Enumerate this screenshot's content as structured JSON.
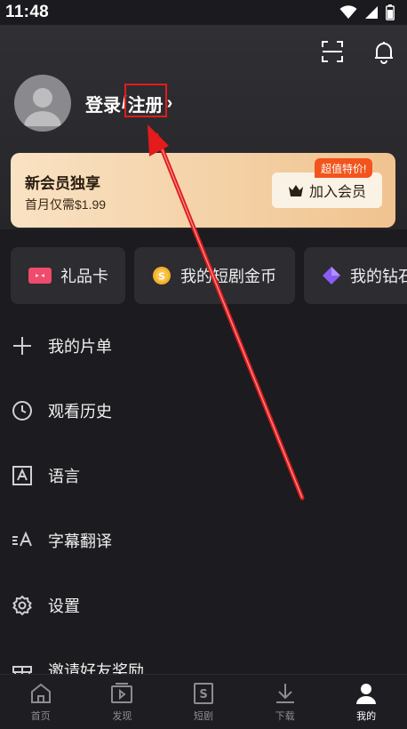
{
  "status_bar": {
    "time": "11:48",
    "icons": [
      "wifi-icon",
      "signal-icon",
      "battery-icon"
    ]
  },
  "header": {
    "icons": [
      "scan-icon",
      "bell-icon"
    ],
    "login_label": "登录",
    "separator": "/",
    "register_label": "注册",
    "chevron": "›"
  },
  "vip": {
    "title": "新会员独享",
    "price_text": "首月仅需$1.99",
    "badge": "超值特价!",
    "join_label": "加入会员",
    "colors": {
      "card_start": "#f9e2c3",
      "card_end": "#f0c38f",
      "badge": "#f2541c"
    }
  },
  "quick_actions": [
    {
      "label": "礼品卡",
      "icon": "gift-card-icon"
    },
    {
      "label": "我的短剧金币",
      "icon": "coin-icon"
    },
    {
      "label": "我的钻石",
      "icon": "diamond-icon"
    }
  ],
  "menu": [
    {
      "label": "我的片单",
      "icon": "plus-icon"
    },
    {
      "label": "观看历史",
      "icon": "clock-icon"
    },
    {
      "label": "语言",
      "icon": "language-icon"
    },
    {
      "label": "字幕翻译",
      "icon": "subtitle-icon"
    },
    {
      "label": "设置",
      "icon": "gear-icon"
    },
    {
      "label": "邀请好友奖励",
      "icon": "gift-icon"
    }
  ],
  "tabs": [
    {
      "label": "首页",
      "icon": "home-icon",
      "active": false
    },
    {
      "label": "发现",
      "icon": "play-icon",
      "active": false
    },
    {
      "label": "短剧",
      "icon": "short-drama-icon",
      "active": false
    },
    {
      "label": "下载",
      "icon": "download-icon",
      "active": false
    },
    {
      "label": "我的",
      "icon": "user-icon",
      "active": true
    }
  ],
  "annotation": {
    "color": "#e31b1b"
  }
}
